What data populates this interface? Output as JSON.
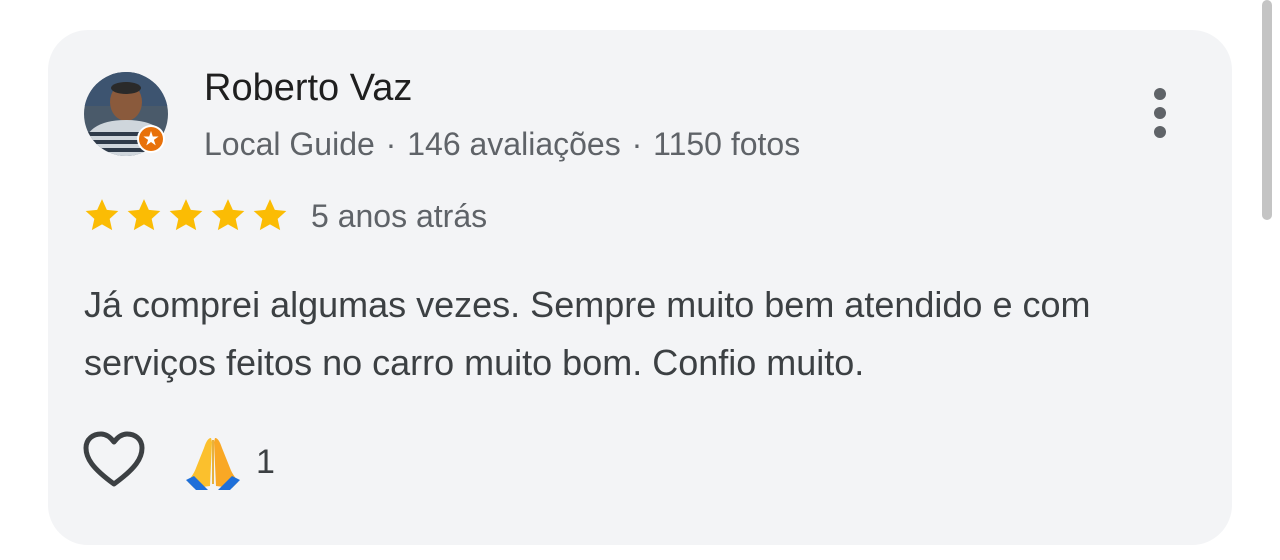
{
  "review": {
    "author": {
      "name": "Roberto Vaz",
      "level": "Local Guide",
      "separator": "·",
      "reviews_count": "146 avaliações",
      "photos_count": "1150 fotos",
      "badge_icon": "local-guide-badge-icon"
    },
    "rating": {
      "stars": 5,
      "max": 5,
      "color": "#fbbc04"
    },
    "date": "5 anos atrás",
    "text": "Já comprei algumas vezes. Sempre muito bem atendido e com serviços feitos no carro muito bom. Confio muito.",
    "actions": {
      "like_icon": "heart-outline-icon",
      "reaction_icon": "folded-hands-icon",
      "reaction_count": "1"
    },
    "menu_icon": "more-vert-icon"
  },
  "colors": {
    "card_bg": "#f3f4f6",
    "badge": "#e8710a",
    "text_primary": "#1f1f1f",
    "text_secondary": "#5f6368"
  }
}
